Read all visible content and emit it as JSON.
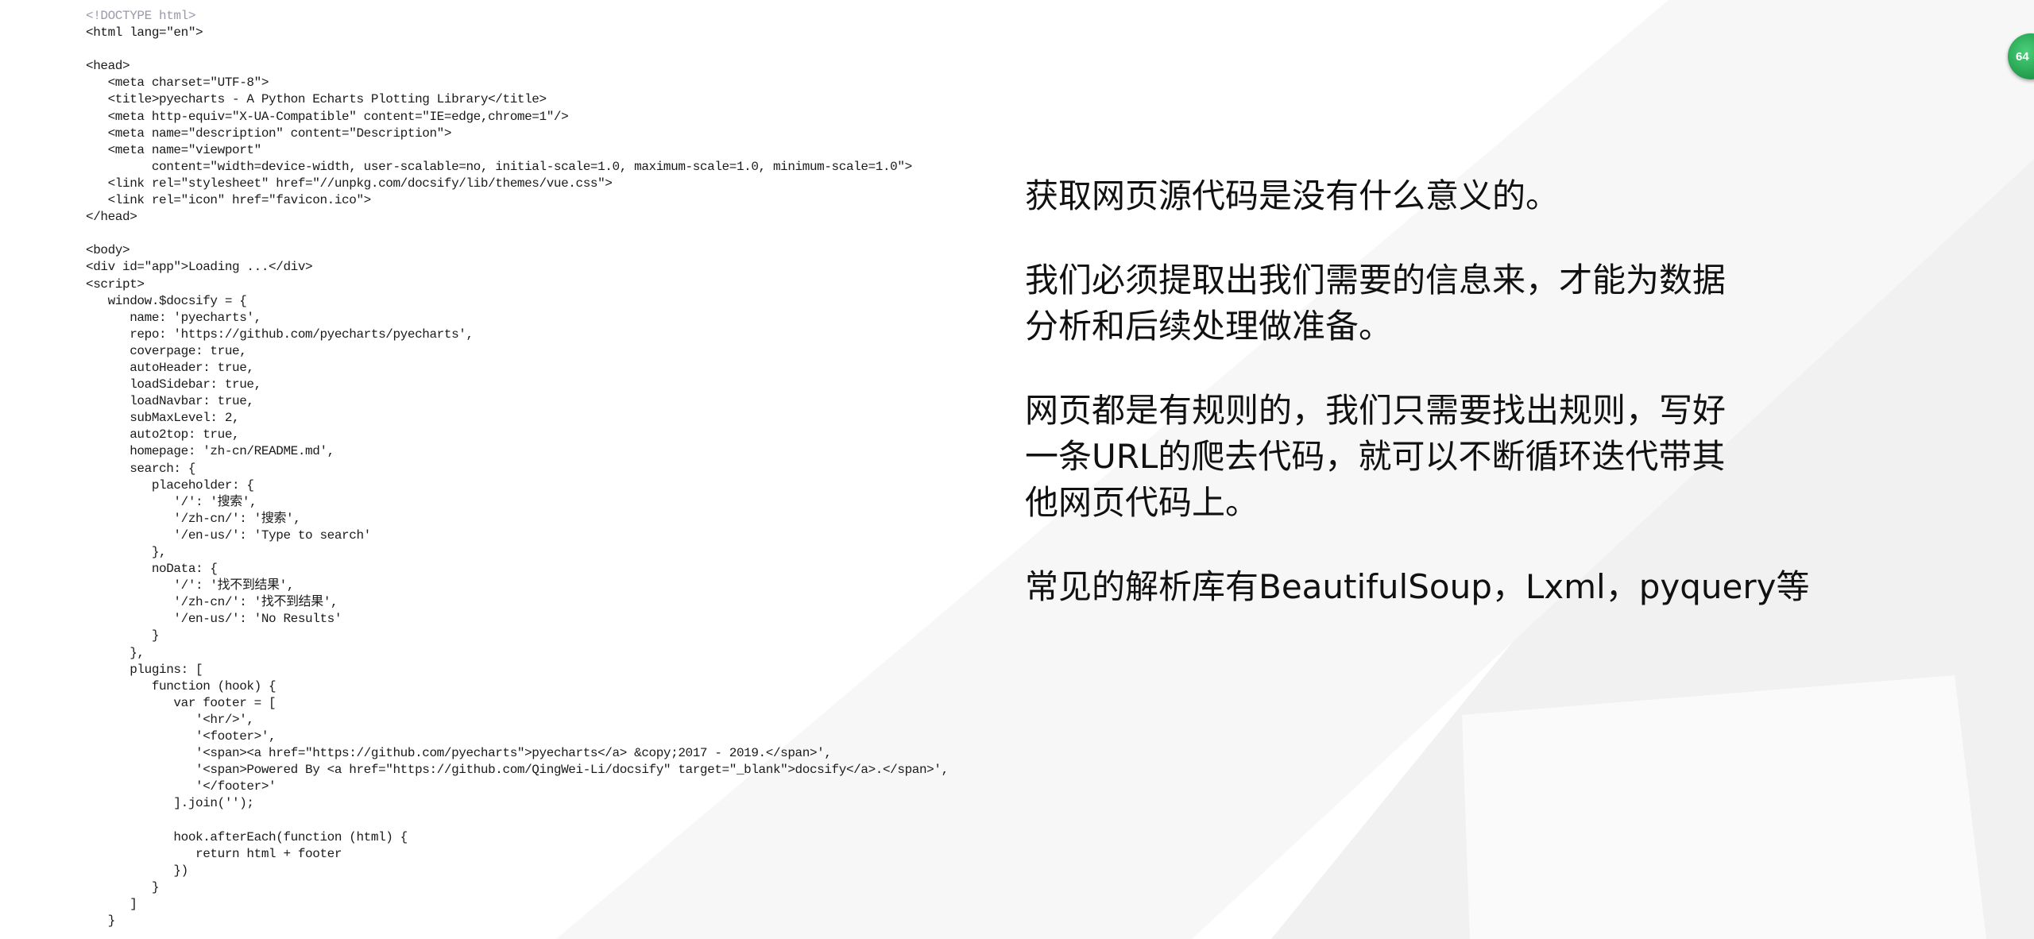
{
  "code": {
    "lines": [
      "<!DOCTYPE html>",
      "<html lang=\"en\">",
      "",
      "<head>",
      "   <meta charset=\"UTF-8\">",
      "   <title>pyecharts - A Python Echarts Plotting Library</title>",
      "   <meta http-equiv=\"X-UA-Compatible\" content=\"IE=edge,chrome=1\"/>",
      "   <meta name=\"description\" content=\"Description\">",
      "   <meta name=\"viewport\"",
      "         content=\"width=device-width, user-scalable=no, initial-scale=1.0, maximum-scale=1.0, minimum-scale=1.0\">",
      "   <link rel=\"stylesheet\" href=\"//unpkg.com/docsify/lib/themes/vue.css\">",
      "   <link rel=\"icon\" href=\"favicon.ico\">",
      "</head>",
      "",
      "<body>",
      "<div id=\"app\">Loading ...</div>",
      "<script>",
      "   window.$docsify = {",
      "      name: 'pyecharts',",
      "      repo: 'https://github.com/pyecharts/pyecharts',",
      "      coverpage: true,",
      "      autoHeader: true,",
      "      loadSidebar: true,",
      "      loadNavbar: true,",
      "      subMaxLevel: 2,",
      "      auto2top: true,",
      "      homepage: 'zh-cn/README.md',",
      "      search: {",
      "         placeholder: {",
      "            '/': '搜索',",
      "            '/zh-cn/': '搜索',",
      "            '/en-us/': 'Type to search'",
      "         },",
      "         noData: {",
      "            '/': '找不到结果',",
      "            '/zh-cn/': '找不到结果',",
      "            '/en-us/': 'No Results'",
      "         }",
      "      },",
      "      plugins: [",
      "         function (hook) {",
      "            var footer = [",
      "               '<hr/>',",
      "               '<footer>',",
      "               '<span><a href=\"https://github.com/pyecharts\">pyecharts</a> &copy;2017 - 2019.</span>',",
      "               '<span>Powered By <a href=\"https://github.com/QingWei-Li/docsify\" target=\"_blank\">docsify</a>.</span>',",
      "               '</footer>'",
      "            ].join('');",
      "",
      "            hook.afterEach(function (html) {",
      "               return html + footer",
      "            })",
      "         }",
      "      ]",
      "   }"
    ]
  },
  "notes": {
    "paragraphs": [
      {
        "lines": [
          "获取网页源代码是没有什么意义的。"
        ]
      },
      {
        "lines": [
          "我们必须提取出我们需要的信息来，才能为数据",
          "分析和后续处理做准备。"
        ]
      },
      {
        "lines": [
          "网页都是有规则的，我们只需要找出规则，写好",
          "一条URL的爬去代码，就可以不断循环迭代带其",
          "他网页代码上。"
        ]
      },
      {
        "lines": [
          "常见的解析库有BeautifulSoup，Lxml，pyquery等"
        ]
      }
    ]
  },
  "badge": {
    "label": "64"
  },
  "colors": {
    "badge": "#1f9a4a",
    "code_tag": "#3b2a9a",
    "link": "#1f2fb5"
  }
}
